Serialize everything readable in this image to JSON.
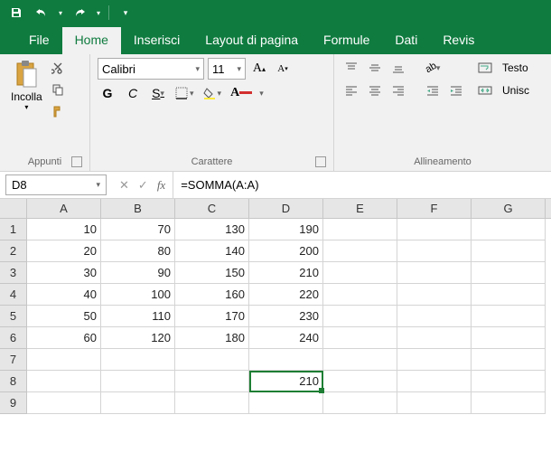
{
  "titlebar": {
    "save": "save",
    "undo": "undo",
    "redo": "redo"
  },
  "tabs": {
    "file": "File",
    "home": "Home",
    "insert": "Inserisci",
    "layout": "Layout di pagina",
    "formulas": "Formule",
    "data": "Dati",
    "review": "Revis"
  },
  "ribbon": {
    "clipboard": {
      "paste": "Incolla",
      "label": "Appunti"
    },
    "font": {
      "name": "Calibri",
      "size": "11",
      "bold": "G",
      "italic": "C",
      "underline": "S",
      "label": "Carattere"
    },
    "alignment": {
      "wrap": "Testo",
      "merge": "Unisc",
      "label": "Allineamento"
    }
  },
  "formula_bar": {
    "cell_ref": "D8",
    "formula": "=SOMMA(A:A)"
  },
  "columns": [
    "A",
    "B",
    "C",
    "D",
    "E",
    "F",
    "G"
  ],
  "rows": [
    "1",
    "2",
    "3",
    "4",
    "5",
    "6",
    "7",
    "8",
    "9"
  ],
  "data": {
    "r1": {
      "a": "10",
      "b": "70",
      "c": "130",
      "d": "190"
    },
    "r2": {
      "a": "20",
      "b": "80",
      "c": "140",
      "d": "200"
    },
    "r3": {
      "a": "30",
      "b": "90",
      "c": "150",
      "d": "210"
    },
    "r4": {
      "a": "40",
      "b": "100",
      "c": "160",
      "d": "220"
    },
    "r5": {
      "a": "50",
      "b": "110",
      "c": "170",
      "d": "230"
    },
    "r6": {
      "a": "60",
      "b": "120",
      "c": "180",
      "d": "240"
    },
    "r8": {
      "d": "210"
    }
  }
}
